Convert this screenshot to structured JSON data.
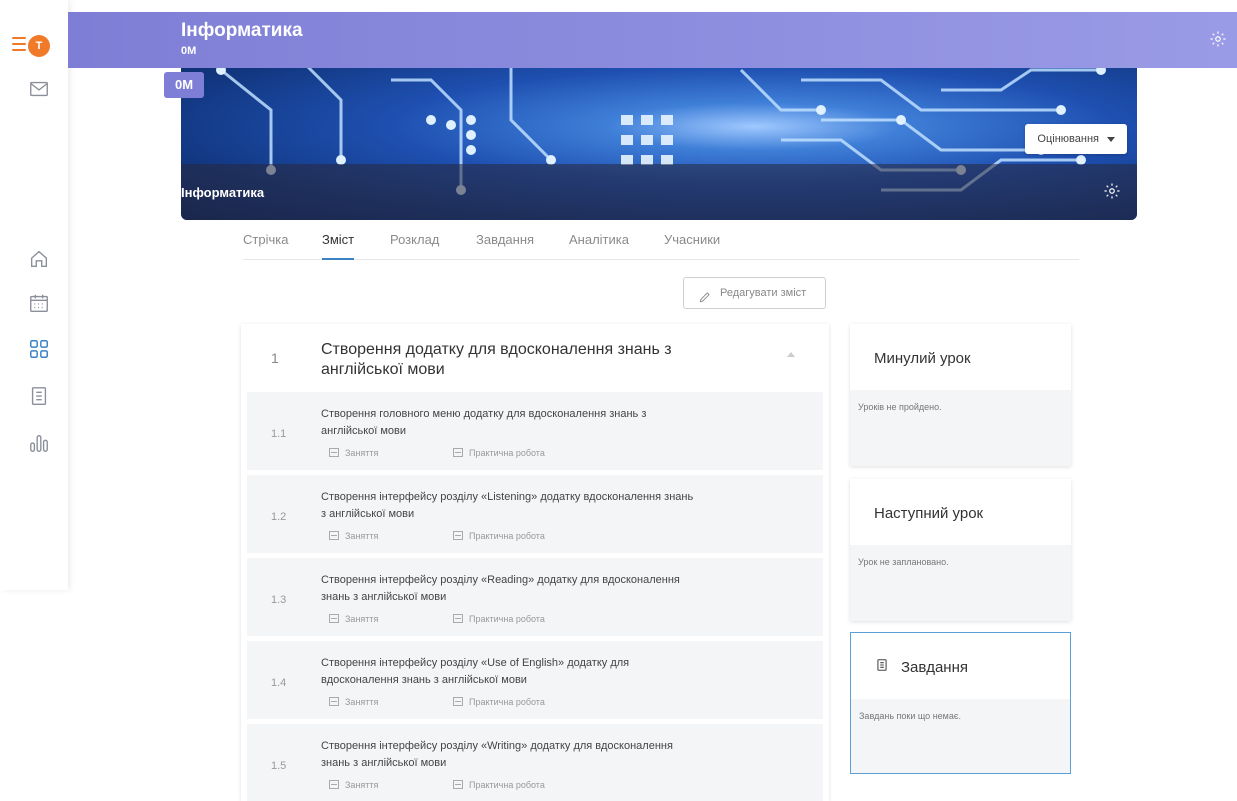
{
  "rail": {
    "avatar_letter": "T",
    "icons": [
      "menu-icon",
      "mail-icon",
      "home-icon",
      "calendar-icon",
      "grid-icon",
      "clipboard-icon",
      "chart-icon"
    ],
    "accent": "#f07a2a",
    "active_color": "#3b82c4"
  },
  "topbar": {
    "title": "Інформатика",
    "subtitle": "0M",
    "color": "#8787dc"
  },
  "hero": {
    "badge": "0M",
    "caption": "Інформатика",
    "grade_button": "Оцінювання"
  },
  "tabs": [
    {
      "label": "Стрічка",
      "active": false
    },
    {
      "label": "Зміст",
      "active": true
    },
    {
      "label": "Розклад",
      "active": false
    },
    {
      "label": "Завдання",
      "active": false
    },
    {
      "label": "Аналітика",
      "active": false
    },
    {
      "label": "Учасники",
      "active": false
    }
  ],
  "edit_button": "Редагувати зміст",
  "section": {
    "number": "1",
    "title": "Створення  додатку для вдосконалення знань з англійської мови"
  },
  "lessons": [
    {
      "number": "1.1",
      "title": "Створення головного меню додатку для вдосконалення знань з англійської мови",
      "tag1": "Заняття",
      "tag2": "Практична робота"
    },
    {
      "number": "1.2",
      "title": "Створення інтерфейсу розділу «Listening» додатку вдосконалення знань з англійської мови",
      "tag1": "Заняття",
      "tag2": "Практична робота"
    },
    {
      "number": "1.3",
      "title": "Створення інтерфейсу розділу «Reading» додатку для вдосконалення знань з англійської мови",
      "tag1": "Заняття",
      "tag2": "Практична робота"
    },
    {
      "number": "1.4",
      "title": "Створення інтерфейсу розділу «Use of English» додатку для вдосконалення знань з англійської мови",
      "tag1": "Заняття",
      "tag2": "Практична робота"
    },
    {
      "number": "1.5",
      "title": "Створення інтерфейсу розділу «Writing» додатку для вдосконалення знань з англійської мови",
      "tag1": "Заняття",
      "tag2": "Практична робота"
    }
  ],
  "side": {
    "past": {
      "title": "Минулий урок",
      "text": "Уроків не пройдено."
    },
    "next": {
      "title": "Наступний урок",
      "text": "Урок не заплановано."
    },
    "tasks": {
      "title": "Завдання",
      "text": "Завдань поки що немає."
    }
  }
}
